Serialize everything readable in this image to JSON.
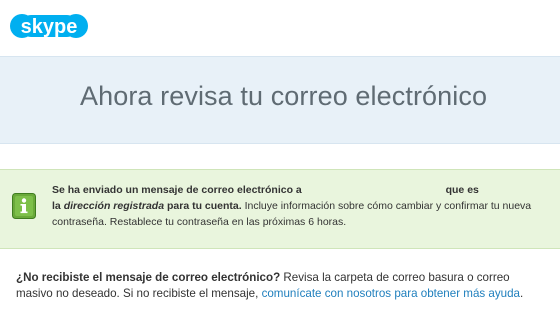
{
  "brand": {
    "name": "skype",
    "color": "#00aff0"
  },
  "banner": {
    "title": "Ahora revisa tu correo electrónico"
  },
  "notice": {
    "icon": "info-icon",
    "line1_start": "Se ha enviado un mensaje de correo electrónico a",
    "line1_end": "que es",
    "la": "la",
    "registered_address": "dirección registrada",
    "for_account": "para tu cuenta.",
    "body": "Incluye información sobre cómo cambiar y confirmar tu nueva contraseña. Restablece tu contraseña en las próximas 6 horas."
  },
  "help": {
    "question": "¿No recibiste el mensaje de correo electrónico?",
    "text": "Revisa la carpeta de correo basura o correo masivo no deseado. Si no recibiste el mensaje,",
    "link": "comunícate con nosotros para obtener más ayuda",
    "end": "."
  },
  "colors": {
    "banner_bg": "#e8f1f8",
    "notice_bg": "#e9f5dd",
    "info_icon": "#6aa93a",
    "link": "#1f7fbd"
  }
}
